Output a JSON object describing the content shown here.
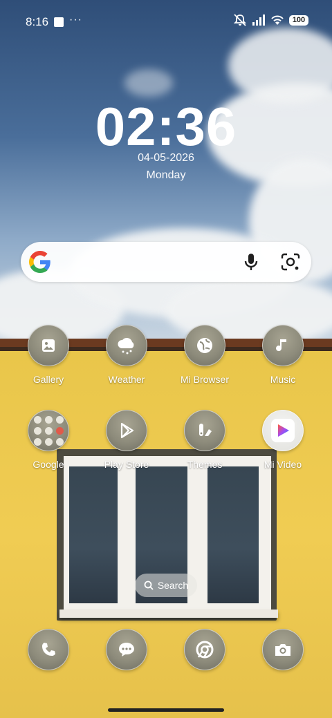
{
  "status_bar": {
    "time": "8:16",
    "more": "···",
    "battery": "100"
  },
  "clock_widget": {
    "time": "02:36",
    "date": "04-05-2026",
    "day": "Monday"
  },
  "search_widget": {
    "provider": "Google"
  },
  "apps_row1": [
    {
      "label": "Gallery",
      "icon": "gallery-icon"
    },
    {
      "label": "Weather",
      "icon": "weather-icon"
    },
    {
      "label": "Mi Browser",
      "icon": "browser-icon"
    },
    {
      "label": "Music",
      "icon": "music-icon"
    }
  ],
  "apps_row2": [
    {
      "label": "Google",
      "icon": "google-folder-icon"
    },
    {
      "label": "Play Store",
      "icon": "play-store-icon"
    },
    {
      "label": "Themes",
      "icon": "themes-icon"
    },
    {
      "label": "Mi Video",
      "icon": "mi-video-icon"
    }
  ],
  "app_search": {
    "label": "Search"
  },
  "dock": [
    {
      "icon": "phone-icon"
    },
    {
      "icon": "messages-icon"
    },
    {
      "icon": "chrome-icon"
    },
    {
      "icon": "camera-icon"
    }
  ]
}
